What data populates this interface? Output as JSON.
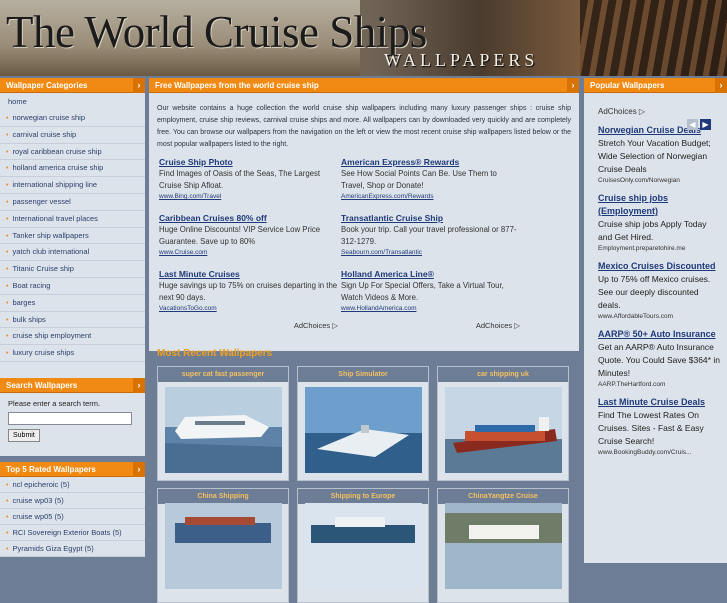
{
  "header": {
    "title": "The World Cruise Ships",
    "subtitle": "WALLPAPERS"
  },
  "left": {
    "categories_title": "Wallpaper Categories",
    "home": "home",
    "categories": [
      "norwegian cruise ship",
      "carnival cruise ship",
      "royal caribbean cruise ship",
      "holland america cruise ship",
      "international shipping line",
      "passenger vessel",
      "International travel places",
      "Tanker ship wallpapers",
      "yatch club international",
      "Titanic Cruise ship",
      "Boat racing",
      "barges",
      "bulk ships",
      "cruise ship employment",
      "luxury cruise ships"
    ],
    "search_title": "Search Wallpapers",
    "search_label": "Please enter a search term.",
    "search_button": "Submit",
    "top_title": "Top 5 Rated Wallpapers",
    "top_rated": [
      "ncl epicheroic (5)",
      "cruise wp03 (5)",
      "cruise wp05 (5)",
      "RCI Sovereign Exterior Boats (5)",
      "Pyramids Giza Egypt (5)"
    ]
  },
  "center": {
    "title": "Free Wallpapers from the world cruise ship",
    "intro": "Our website contains a huge collection the world cruise ship wallpapers including many luxury passenger ships : cruise ship employment, cruise ship reviews, carnival cruise ships and more. All wallpapers can by downloaded very quickly and are completely free. You can browse our wallpapers from the navigation on the left or view the most recent cruise ship wallpapers listed below or the most popular wallpapers listed to the right.",
    "ads": [
      {
        "h": "Cruise Ship Photo",
        "d": "Find Images of Oasis of the Seas, The Largest Cruise Ship Afloat.",
        "u": "www.Bing.com/Travel"
      },
      {
        "h": "American Express® Rewards",
        "d": "See How Social Points Can Be. Use Them to Travel, Shop or Donate!",
        "u": "AmericanExpress.com/Rewards"
      },
      {
        "h": "Caribbean Cruises 80% off",
        "d": "Huge Online Discounts! VIP Service Low Price Guarantee. Save up to 80%",
        "u": "www.Cruise.com"
      },
      {
        "h": "Transatlantic Cruise Ship",
        "d": "Book your trip. Call your travel professional or 877-312-1279.",
        "u": "Seabourn.com/Transatlantic"
      },
      {
        "h": "Last Minute Cruises",
        "d": "Huge savings up to 75% on cruises departing in the next 90 days.",
        "u": "VacationsToGo.com"
      },
      {
        "h": "Holland America Line®",
        "d": "Sign Up For Special Offers, Take a Virtual Tour, Watch Videos & More.",
        "u": "www.HollandAmerica.com"
      }
    ],
    "adchoices": "AdChoices",
    "recent_title": "Most Recent Wallpapers",
    "thumbs": [
      "super cat fast passenger",
      "Ship Simulator",
      "car shipping uk",
      "China Shipping",
      "Shipping to Europe",
      "ChinaYangtze Cruise"
    ]
  },
  "right": {
    "title": "Popular Wallpapers",
    "adchoices": "AdChoices",
    "ads": [
      {
        "h": "Norwegian Cruise Deals",
        "d": "Stretch Your Vacation Budget; Wide Selection of Norwegian Cruise Deals",
        "u": "CruisesOnly.com/Norwegian"
      },
      {
        "h": "Cruise ship jobs (Employment)",
        "d": "Cruise ship jobs Apply Today and Get Hired.",
        "u": "Employment.preparetohire.me"
      },
      {
        "h": "Mexico Cruises Discounted",
        "d": "Up to 75% off Mexico cruises. See our deeply discounted deals.",
        "u": "www.AffordableTours.com"
      },
      {
        "h": "AARP® 50+ Auto Insurance",
        "d": "Get an AARP® Auto Insurance Quote. You Could Save $364* in Minutes!",
        "u": "AARP.TheHartford.com"
      },
      {
        "h": "Last Minute Cruise Deals",
        "d": "Find The Lowest Rates On Cruises. Sites - Fast & Easy Cruise Search!",
        "u": "www.BookingBuddy.com/Cruis..."
      }
    ]
  },
  "colors": {
    "accent": "#f08a12",
    "link": "#1f3a7a",
    "panel": "#dde3ea",
    "background": "#6d7d95"
  }
}
